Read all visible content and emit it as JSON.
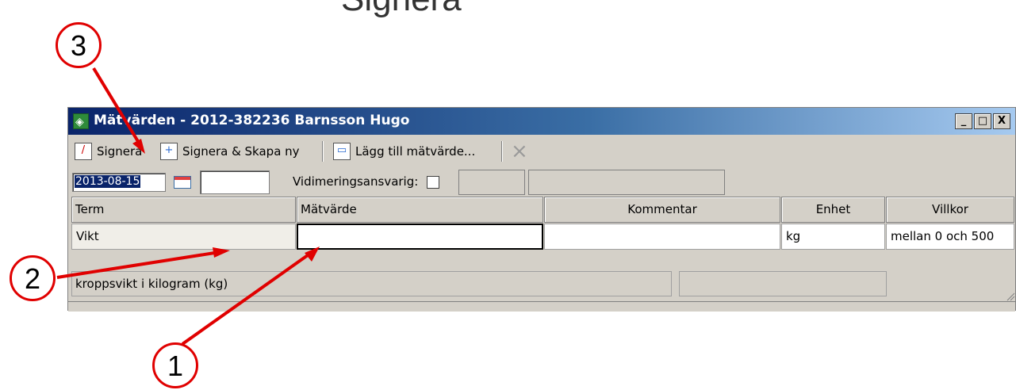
{
  "top_text": "Signera",
  "window": {
    "title": "Mätvärden -  2012-382236 Barnsson Hugo",
    "controls": {
      "minimize": "_",
      "maximize": "□",
      "close": "X"
    }
  },
  "toolbar": {
    "sign_label": "Signera",
    "sign_new_label": "Signera & Skapa ny",
    "add_value_label": "Lägg till mätvärde...",
    "delete_glyph": "×"
  },
  "fields": {
    "date_value": "2013-08-15",
    "time_value": "",
    "verifier_label": "Vidimeringsansvarig:"
  },
  "grid": {
    "columns": [
      "Term",
      "Mätvärde",
      "Kommentar",
      "Enhet",
      "Villkor"
    ],
    "rows": [
      {
        "term": "Vikt",
        "value": "",
        "comment": "",
        "unit": "kg",
        "condition": "mellan 0 och 500"
      }
    ]
  },
  "status": {
    "description": "kroppsvikt i kilogram (kg)"
  },
  "callouts": [
    "1",
    "2",
    "3"
  ],
  "colors": {
    "callout_red": "#e00000",
    "title_blue": "#0a246a"
  }
}
